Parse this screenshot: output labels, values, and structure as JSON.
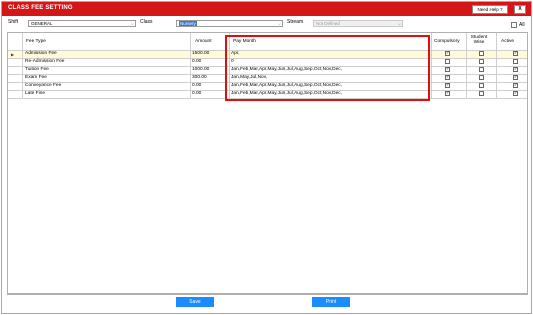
{
  "window": {
    "title": "CLASS FEE SETTING",
    "help_label": "Need Help ?",
    "close_label": "X"
  },
  "filters": {
    "shift_label": "Shift",
    "shift_value": "GENERAL",
    "class_label": "Class",
    "class_value": "Nursery",
    "stream_label": "Stream",
    "stream_value": "Not Defined",
    "all_label": "All"
  },
  "grid": {
    "columns": [
      "Fee Type",
      "Amount",
      "Pay Month",
      "Compulsory",
      "Student Wise",
      "Active"
    ],
    "rows": [
      {
        "fee_type": "Admission Fee",
        "amount": "1500.00",
        "pay_month": "Apr,",
        "compulsory": true,
        "student_wise": false,
        "active": true
      },
      {
        "fee_type": "Re-Admission Fee",
        "amount": "0.00",
        "pay_month": "0",
        "compulsory": false,
        "student_wise": false,
        "active": false
      },
      {
        "fee_type": "Tuition Fee",
        "amount": "1000.00",
        "pay_month": "Jan,Feb,Mar,Apr,May,Jun,Jul,Aug,Sep,Oct,Nov,Dec,",
        "compulsory": true,
        "student_wise": false,
        "active": true
      },
      {
        "fee_type": "Exam Fee",
        "amount": "300.00",
        "pay_month": "Jan,May,Jul,Nov,",
        "compulsory": true,
        "student_wise": false,
        "active": true
      },
      {
        "fee_type": "Conveyance Fee",
        "amount": "0.00",
        "pay_month": "Jan,Feb,Mar,Apr,May,Jun,Jul,Aug,Sep,Oct,Nov,Dec,",
        "compulsory": true,
        "student_wise": false,
        "active": true
      },
      {
        "fee_type": "Late Fine",
        "amount": "0.00",
        "pay_month": "Jan,Feb,Mar,Apr,May,Jun,Jul,Aug,Sep,Oct,Nov,Dec,",
        "compulsory": true,
        "student_wise": false,
        "active": true
      }
    ]
  },
  "footer": {
    "save_label": "Save",
    "print_label": "Print"
  },
  "colors": {
    "titlebar": "#d51616",
    "button": "#1a8cff",
    "highlight": "#e10e0e"
  }
}
